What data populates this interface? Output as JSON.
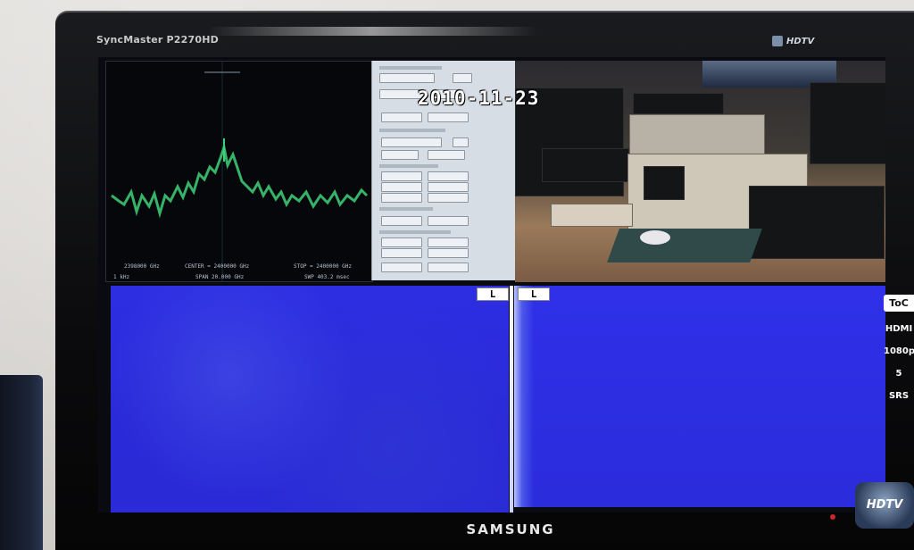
{
  "monitor": {
    "model_label": "SyncMaster P2270HD",
    "hdtv_label": "HDTV",
    "brand_label": "SAMSUNG",
    "side_badges": [
      "ToC",
      "HDMI",
      "1080p",
      "5",
      "SRS"
    ],
    "hdtv_sticker": "HDTV"
  },
  "screen": {
    "timestamp": "2010-11-23",
    "spectrum_footer": {
      "left": "2398000 GHz",
      "center": "CENTER = 2400000 GHz",
      "stop": "STOP = 2400000 GHz",
      "bottom_left": "1 kHz",
      "span": "SPAN 20.000 GHz",
      "sweep": "SWP 403.2 msec"
    },
    "waterfall_markers": [
      "L",
      "L"
    ]
  },
  "colors": {
    "waterfall": "#2b2cdc",
    "trace": "#3fd07a",
    "panel": "#d7dde5"
  }
}
